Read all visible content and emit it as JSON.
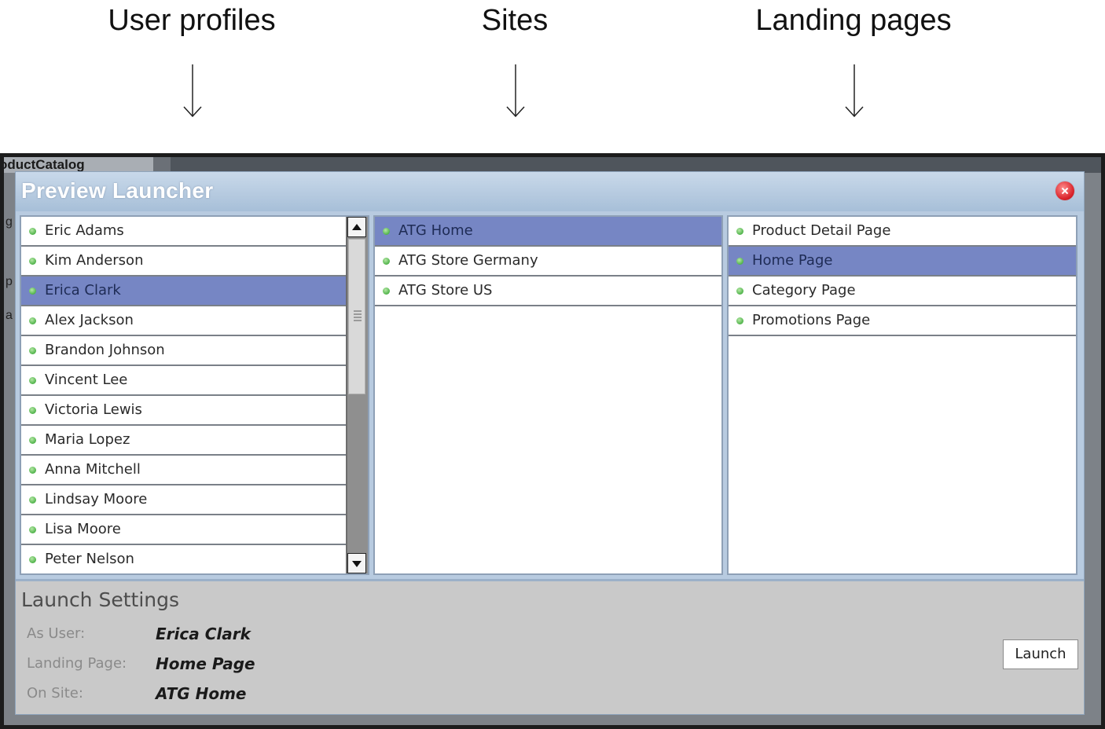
{
  "annotations": {
    "user_profiles": "User profiles",
    "sites": "Sites",
    "landing_pages": "Landing pages"
  },
  "background_window": {
    "title": "oductCatalog",
    "edge_letters": [
      "g",
      "p",
      "a"
    ]
  },
  "dialog": {
    "title": "Preview Launcher",
    "close_icon": "close-icon"
  },
  "users": {
    "items": [
      {
        "label": "Eric Adams",
        "selected": false
      },
      {
        "label": "Kim Anderson",
        "selected": false
      },
      {
        "label": "Erica Clark",
        "selected": true
      },
      {
        "label": "Alex Jackson",
        "selected": false
      },
      {
        "label": "Brandon Johnson",
        "selected": false
      },
      {
        "label": "Vincent Lee",
        "selected": false
      },
      {
        "label": "Victoria Lewis",
        "selected": false
      },
      {
        "label": "Maria Lopez",
        "selected": false
      },
      {
        "label": "Anna Mitchell",
        "selected": false
      },
      {
        "label": "Lindsay Moore",
        "selected": false
      },
      {
        "label": "Lisa Moore",
        "selected": false
      },
      {
        "label": "Peter Nelson",
        "selected": false
      }
    ]
  },
  "sites": {
    "items": [
      {
        "label": "ATG Home",
        "selected": true
      },
      {
        "label": "ATG Store Germany",
        "selected": false
      },
      {
        "label": "ATG Store US",
        "selected": false
      }
    ]
  },
  "pages": {
    "items": [
      {
        "label": "Product Detail Page",
        "selected": false
      },
      {
        "label": "Home Page",
        "selected": true
      },
      {
        "label": "Category Page",
        "selected": false
      },
      {
        "label": "Promotions Page",
        "selected": false
      }
    ]
  },
  "launch_settings": {
    "title": "Launch Settings",
    "as_user_label": "As User:",
    "as_user_value": "Erica Clark",
    "landing_page_label": "Landing Page:",
    "landing_page_value": "Home Page",
    "on_site_label": "On Site:",
    "on_site_value": "ATG Home",
    "launch_label": "Launch"
  },
  "colors": {
    "selected_row": "#7686c4",
    "status_dot": "#4fb34a",
    "title_text": "#ffffff",
    "close_button": "#d9232b"
  }
}
